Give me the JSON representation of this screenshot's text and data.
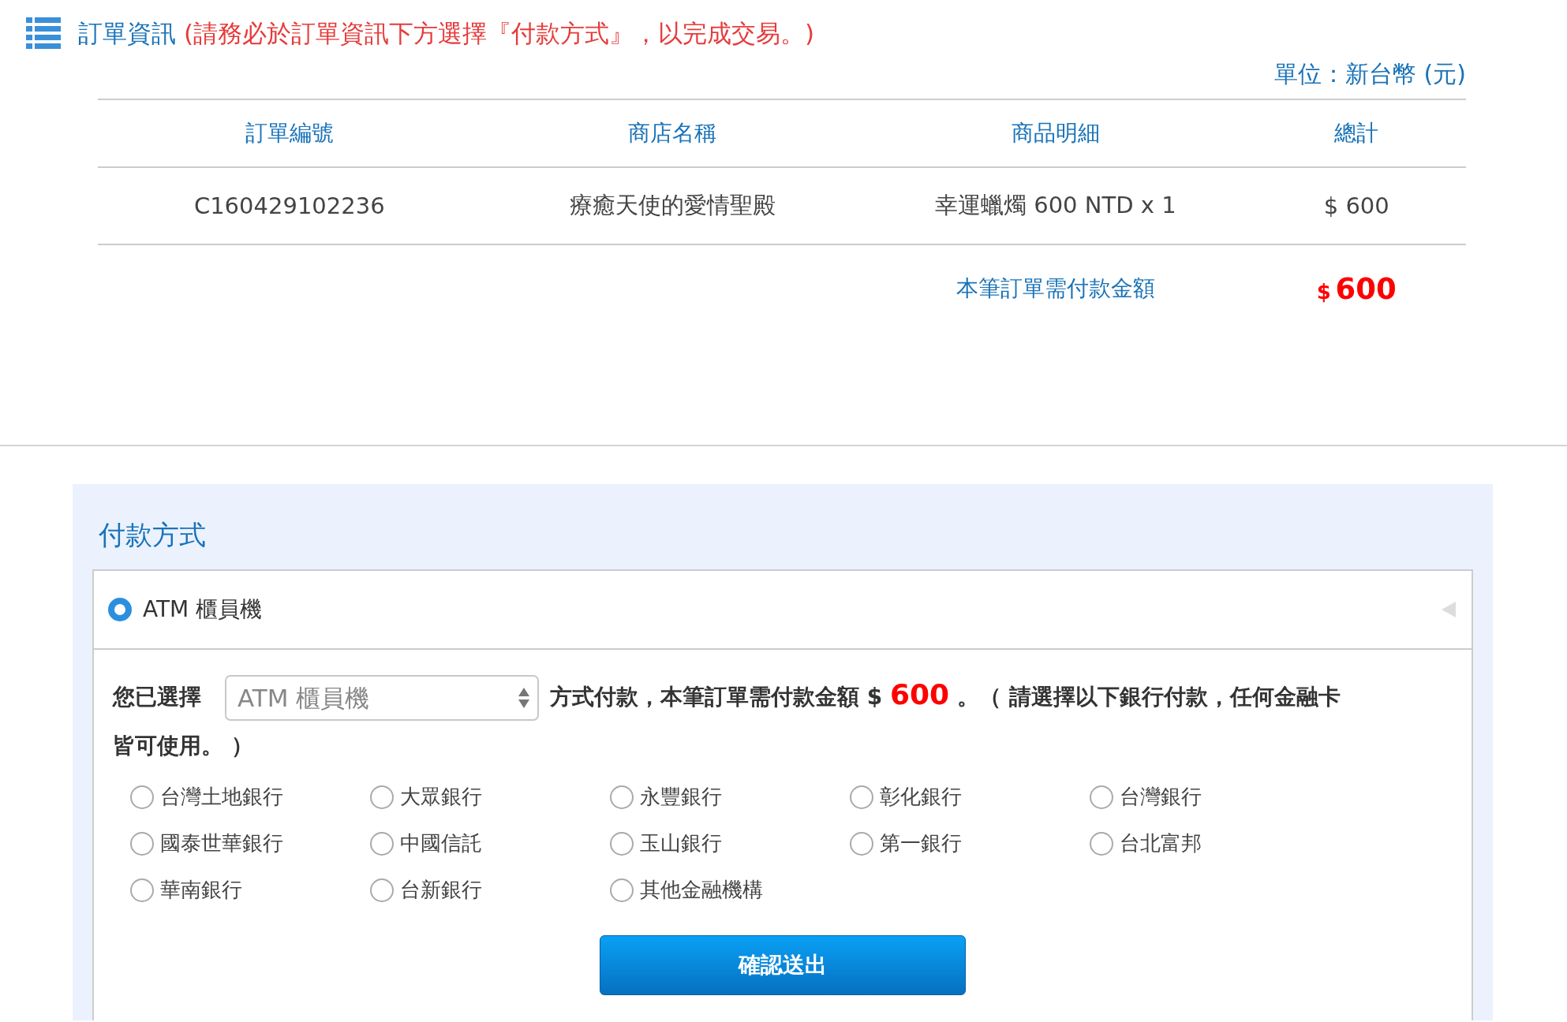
{
  "header": {
    "title": "訂單資訊",
    "notice": "(請務必於訂單資訊下方選擇『付款方式』，以完成交易。)",
    "unit": "單位：新台幣 (元)"
  },
  "order_table": {
    "columns": [
      "訂單編號",
      "商店名稱",
      "商品明細",
      "總計"
    ],
    "rows": [
      [
        "C160429102236",
        "療癒天使的愛情聖殿",
        "幸運蠟燭 600 NTD x 1",
        "$ 600"
      ]
    ]
  },
  "total": {
    "label": "本筆訂單需付款金額",
    "currency": "$",
    "amount": "600"
  },
  "payment": {
    "title": "付款方式",
    "methods": [
      {
        "label": "ATM 櫃員機",
        "selected": true,
        "expanded": true
      }
    ],
    "prefix": "您已選擇",
    "select_value": "ATM 櫃員機",
    "text_before_amount": "方式付款，本筆訂單需付款金額 $ ",
    "amount": "600",
    "text_after_amount": " 。（ 請選擇以下銀行付款，任何金融卡",
    "text_continuation": "皆可使用。 ）",
    "banks": [
      {
        "label": "台灣土地銀行",
        "selected": false
      },
      {
        "label": "大眾銀行",
        "selected": false
      },
      {
        "label": "永豐銀行",
        "selected": false
      },
      {
        "label": "彰化銀行",
        "selected": false
      },
      {
        "label": "台灣銀行",
        "selected": false
      },
      {
        "label": "國泰世華銀行",
        "selected": false
      },
      {
        "label": "中國信託",
        "selected": false
      },
      {
        "label": "玉山銀行",
        "selected": false
      },
      {
        "label": "第一銀行",
        "selected": false
      },
      {
        "label": "台北富邦",
        "selected": false
      },
      {
        "label": "華南銀行",
        "selected": false
      },
      {
        "label": "台新銀行",
        "selected": false
      },
      {
        "label": "其他金融機構",
        "selected": false
      }
    ],
    "submit": "確認送出"
  }
}
